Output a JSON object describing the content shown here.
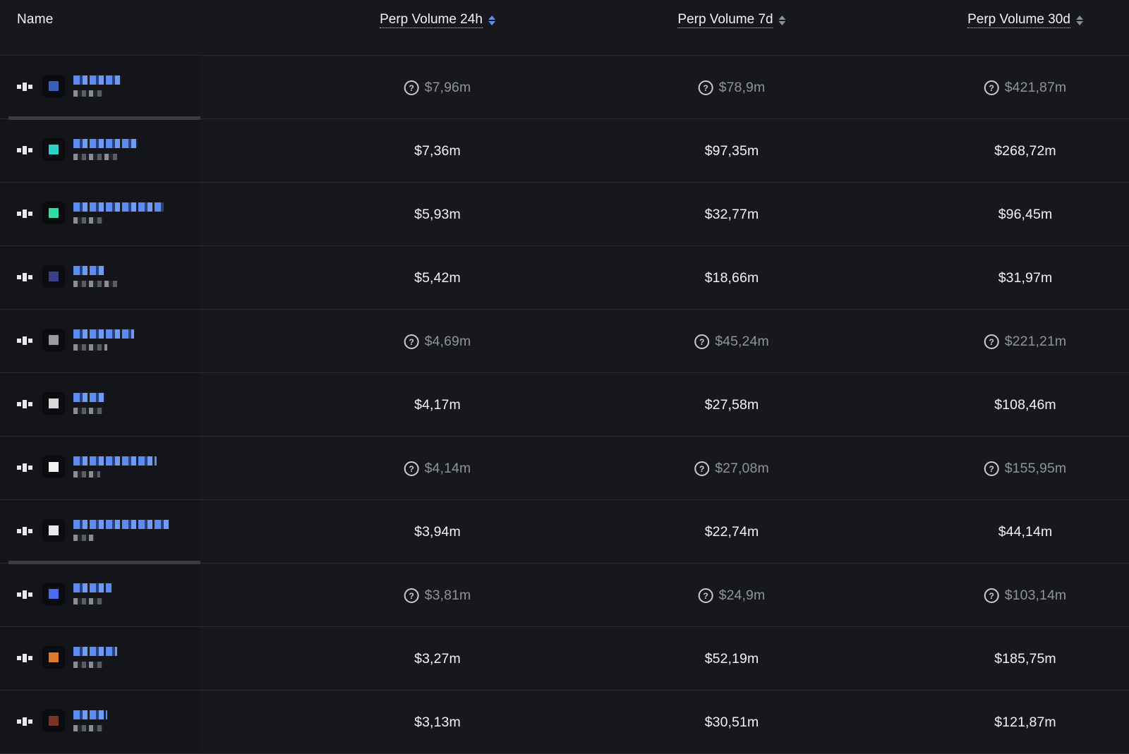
{
  "header": {
    "name_label": "Name",
    "columns": [
      {
        "label": "Perp Volume 24h",
        "sort": "active"
      },
      {
        "label": "Perp Volume 7d",
        "sort": "none"
      },
      {
        "label": "Perp Volume 30d",
        "sort": "none"
      }
    ]
  },
  "icons": {
    "unknown": "question-circle-icon",
    "sort": "sort-arrows-icon"
  },
  "colors": {
    "background": "#17181c",
    "accent_sort": "#5b8df6",
    "link_blue": "#5c8cf2"
  },
  "rows": [
    {
      "muted": true,
      "v24h": "$7,96m",
      "v7d": "$78,9m",
      "v30d": "$421,87m"
    },
    {
      "muted": false,
      "v24h": "$7,36m",
      "v7d": "$97,35m",
      "v30d": "$268,72m"
    },
    {
      "muted": false,
      "v24h": "$5,93m",
      "v7d": "$32,77m",
      "v30d": "$96,45m"
    },
    {
      "muted": false,
      "v24h": "$5,42m",
      "v7d": "$18,66m",
      "v30d": "$31,97m"
    },
    {
      "muted": true,
      "v24h": "$4,69m",
      "v7d": "$45,24m",
      "v30d": "$221,21m"
    },
    {
      "muted": false,
      "v24h": "$4,17m",
      "v7d": "$27,58m",
      "v30d": "$108,46m"
    },
    {
      "muted": true,
      "v24h": "$4,14m",
      "v7d": "$27,08m",
      "v30d": "$155,95m"
    },
    {
      "muted": false,
      "v24h": "$3,94m",
      "v7d": "$22,74m",
      "v30d": "$44,14m"
    },
    {
      "muted": true,
      "v24h": "$3,81m",
      "v7d": "$24,9m",
      "v30d": "$103,14m"
    },
    {
      "muted": false,
      "v24h": "$3,27m",
      "v7d": "$52,19m",
      "v30d": "$185,75m"
    },
    {
      "muted": false,
      "v24h": "$3,13m",
      "v7d": "$30,51m",
      "v30d": "$121,87m"
    }
  ]
}
